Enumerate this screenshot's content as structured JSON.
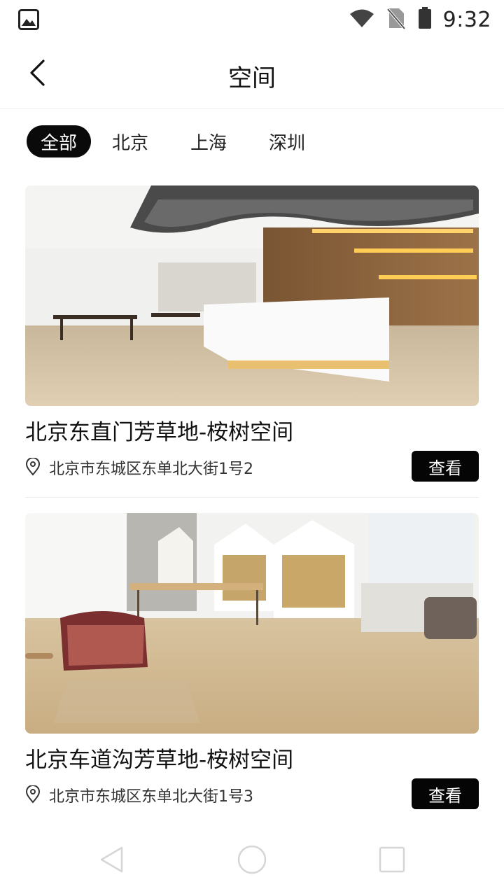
{
  "status_bar": {
    "time": "9:32",
    "icons": [
      "image-notification-icon",
      "wifi-icon",
      "no-sim-icon",
      "battery-icon"
    ]
  },
  "header": {
    "title": "空间",
    "back_icon": "chevron-left-icon"
  },
  "tabs": [
    {
      "label": "全部",
      "active": true
    },
    {
      "label": "北京",
      "active": false
    },
    {
      "label": "上海",
      "active": false
    },
    {
      "label": "深圳",
      "active": false
    }
  ],
  "spaces": [
    {
      "title": "北京东直门芳草地-桉树空间",
      "address": "北京市东城区东单北大街1号2",
      "button_label": "查看",
      "image": "office-reception-photo"
    },
    {
      "title": "北京车道沟芳草地-桉树空间",
      "address": "北京市东城区东单北大街1号3",
      "button_label": "查看",
      "image": "office-lounge-photo"
    }
  ],
  "nav_bar": {
    "buttons": [
      "back-triangle-icon",
      "home-circle-icon",
      "recents-square-icon"
    ]
  },
  "colors": {
    "accent": "#0a0a0a",
    "text": "#111111",
    "secondary_text": "#333333",
    "divider": "#ececec"
  }
}
